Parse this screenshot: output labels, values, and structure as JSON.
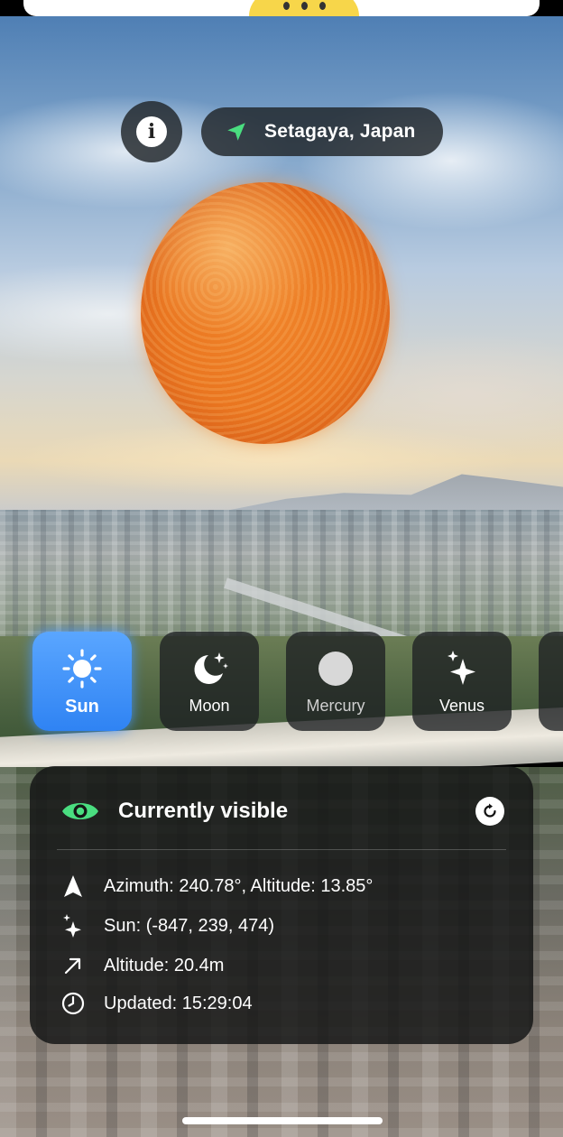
{
  "colors": {
    "accent": "#2f83f3",
    "visible_eye": "#4ade80",
    "location_arrow": "#4ade80",
    "panel_bg": "#141616",
    "sun_orange": "#ea7620"
  },
  "header": {
    "info_icon": "info-icon",
    "location_icon": "location-arrow-icon",
    "location": "Setagaya, Japan"
  },
  "bodies": [
    {
      "label": "Sun",
      "icon": "sun-icon",
      "selected": true
    },
    {
      "label": "Moon",
      "icon": "moon-stars-icon",
      "selected": false
    },
    {
      "label": "Mercury",
      "icon": "circle-icon",
      "selected": false
    },
    {
      "label": "Venus",
      "icon": "sparkles-icon",
      "selected": false
    }
  ],
  "panel": {
    "status": "Currently visible",
    "status_icon": "eye-icon",
    "refresh_icon": "refresh-icon",
    "rows": [
      {
        "icon": "navigation-arrow-icon",
        "text": "Azimuth: 240.78°, Altitude: 13.85°"
      },
      {
        "icon": "sparkles-icon",
        "text": "Sun: (-847, 239, 474)"
      },
      {
        "icon": "arrow-up-right-icon",
        "text": "Altitude: 20.4m"
      },
      {
        "icon": "clock-icon",
        "text": "Updated: 15:29:04"
      }
    ]
  }
}
